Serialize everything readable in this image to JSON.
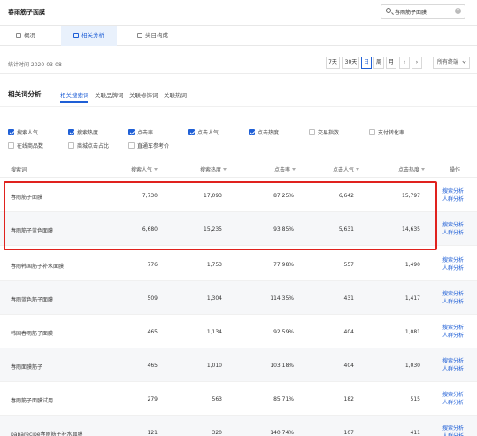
{
  "header": {
    "title": "春雨筋子面膜",
    "search_value": "春雨筋子面膜",
    "clear_symbol": "×"
  },
  "tabs": [
    {
      "label": "概况",
      "active": false
    },
    {
      "label": "相关分析",
      "active": true
    },
    {
      "label": "类目构成",
      "active": false
    }
  ],
  "toolbar": {
    "stat_time": "统计时间 2020-03-08",
    "periods": [
      "7天",
      "30天",
      "日",
      "周",
      "月"
    ],
    "active_period": "日",
    "prev": "‹",
    "next": "›",
    "channel": "所有终端"
  },
  "section": {
    "title": "相关词分析",
    "subtabs": [
      "相关搜索词",
      "关联品牌词",
      "关联修饰词",
      "关联热词"
    ],
    "active_subtab": "相关搜索词"
  },
  "metrics": {
    "row1": [
      {
        "label": "搜索人气",
        "checked": true
      },
      {
        "label": "搜索热度",
        "checked": true
      },
      {
        "label": "点击率",
        "checked": true
      },
      {
        "label": "点击人气",
        "checked": true
      },
      {
        "label": "点击热度",
        "checked": true
      },
      {
        "label": "交易指数",
        "checked": false
      },
      {
        "label": "支付转化率",
        "checked": false
      }
    ],
    "row2": [
      {
        "label": "在线商品数",
        "checked": false
      },
      {
        "label": "商城点击占比",
        "checked": false
      },
      {
        "label": "直通车参考价",
        "checked": false
      }
    ]
  },
  "table": {
    "headers": [
      "搜索词",
      "搜索人气",
      "搜索热度",
      "点击率",
      "点击人气",
      "点击热度",
      "操作"
    ],
    "op_labels": [
      "搜索分析",
      "人群分析"
    ],
    "rows": [
      {
        "keyword": "春雨筋子面膜",
        "search_pop": "7,730",
        "search_heat": "17,093",
        "ctr": "87.25%",
        "click_pop": "6,642",
        "click_heat": "15,797"
      },
      {
        "keyword": "春雨筋子蓝色面膜",
        "search_pop": "6,680",
        "search_heat": "15,235",
        "ctr": "93.85%",
        "click_pop": "5,631",
        "click_heat": "14,635"
      },
      {
        "keyword": "春雨韩国筋子补水面膜",
        "search_pop": "776",
        "search_heat": "1,753",
        "ctr": "77.98%",
        "click_pop": "557",
        "click_heat": "1,490"
      },
      {
        "keyword": "春雨蓝色筋子面膜",
        "search_pop": "509",
        "search_heat": "1,304",
        "ctr": "114.35%",
        "click_pop": "431",
        "click_heat": "1,417"
      },
      {
        "keyword": "韩国春雨筋子面膜",
        "search_pop": "465",
        "search_heat": "1,134",
        "ctr": "92.59%",
        "click_pop": "404",
        "click_heat": "1,081"
      },
      {
        "keyword": "春雨面膜筋子",
        "search_pop": "465",
        "search_heat": "1,010",
        "ctr": "103.18%",
        "click_pop": "404",
        "click_heat": "1,030"
      },
      {
        "keyword": "春雨筋子面膜试用",
        "search_pop": "279",
        "search_heat": "563",
        "ctr": "85.71%",
        "click_pop": "182",
        "click_heat": "515"
      },
      {
        "keyword": "paparecipe春雨筋子补水面膜",
        "search_pop": "121",
        "search_heat": "320",
        "ctr": "140.74%",
        "click_pop": "107",
        "click_heat": "411"
      }
    ]
  },
  "colors": {
    "accent": "#1f5fd6",
    "highlight": "#e0221e",
    "stripe": "#f6f7f9"
  }
}
